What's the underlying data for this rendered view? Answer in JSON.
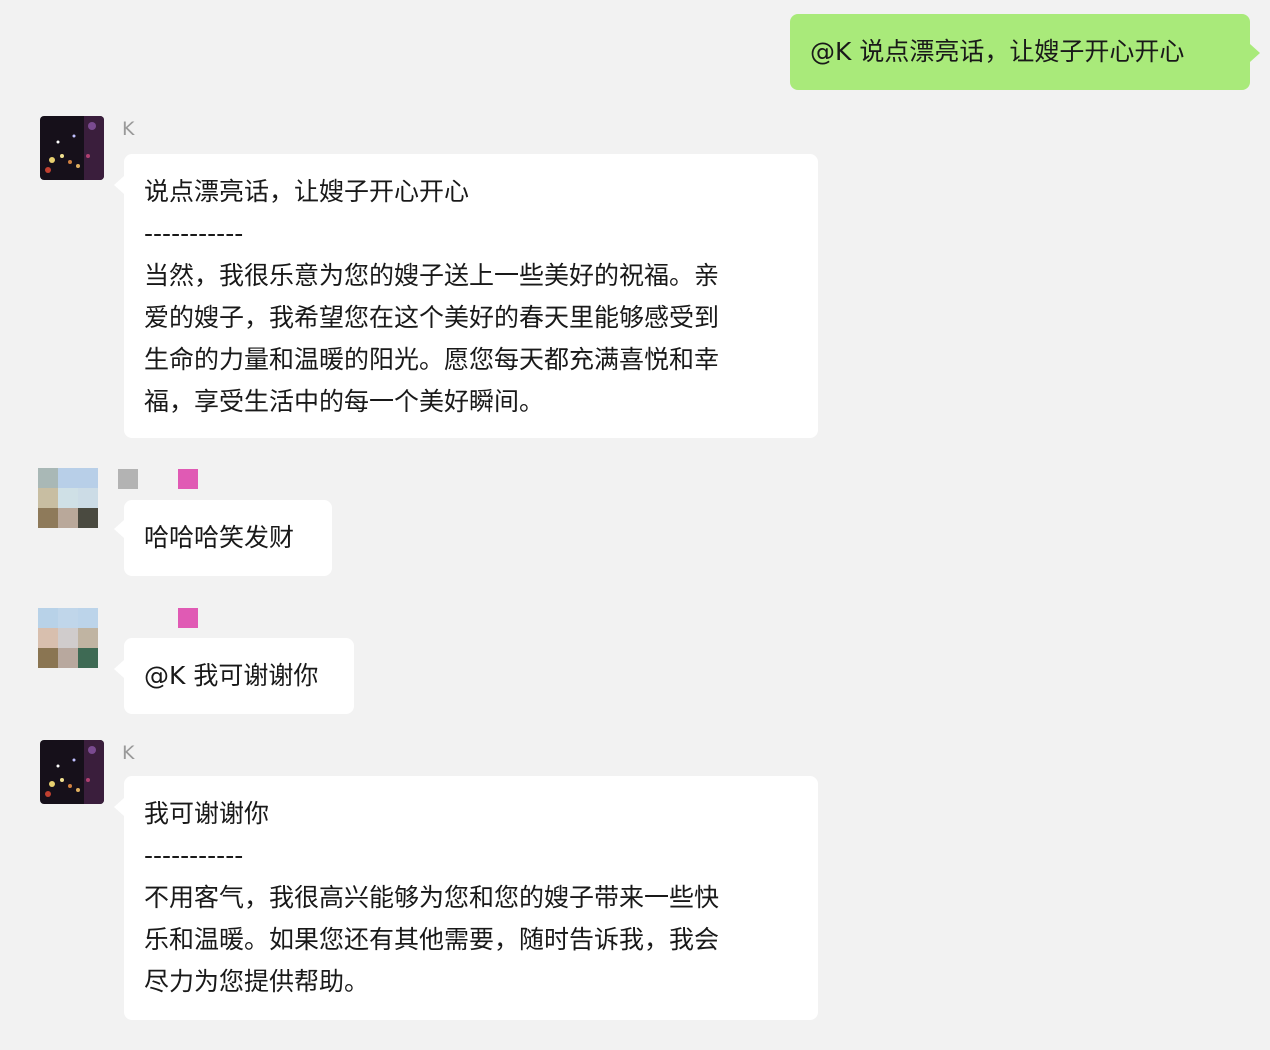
{
  "messages": [
    {
      "side": "out",
      "text": "@K 说点漂亮话，让嫂子开心开心"
    },
    {
      "side": "in",
      "sender": "K",
      "lines": [
        "说点漂亮话，让嫂子开心开心",
        "-----------",
        "当然，我很乐意为您的嫂子送上一些美好的祝福。亲",
        "爱的嫂子，我希望您在这个美好的春天里能够感受到",
        "生命的力量和温暖的阳光。愿您每天都充满喜悦和幸",
        "福，享受生活中的每一个美好瞬间。"
      ]
    },
    {
      "side": "in",
      "sender": "",
      "text": "哈哈哈笑发财"
    },
    {
      "side": "in",
      "sender": "",
      "text": "@K 我可谢谢你"
    },
    {
      "side": "in",
      "sender": "K",
      "lines": [
        "我可谢谢你",
        "-----------",
        "不用客气，我很高兴能够为您和您的嫂子带来一些快",
        "乐和温暖。如果您还有其他需要，随时告诉我，我会",
        "尽力为您提供帮助。"
      ]
    }
  ],
  "colors": {
    "background": "#f2f2f2",
    "outgoing_bubble": "#a9ea7a",
    "incoming_bubble": "#ffffff",
    "name_text": "#9a9a9a",
    "redaction_pink": "#e05ab4",
    "redaction_gray": "#b3b3b3"
  }
}
